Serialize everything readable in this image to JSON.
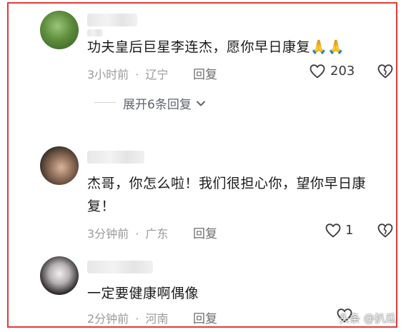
{
  "comments": [
    {
      "text": "功夫皇后巨星李连杰，愿你早日康复🙏🙏",
      "time": "3小时前",
      "location": "辽宁",
      "reply_label": "回复",
      "like_count": "203",
      "expand_label": "展开6条回复"
    },
    {
      "text_line1": "杰哥，你怎么啦！我们很担心你，望你早日康",
      "text_line2": "复！",
      "time": "3分钟前",
      "location": "广东",
      "reply_label": "回复",
      "like_count": "1"
    },
    {
      "text": "一定要健康啊偶像",
      "time": "2分钟前",
      "location": "河南",
      "reply_label": "回复"
    }
  ],
  "separator": "·",
  "watermark": "头条 @扒瓜",
  "colors": {
    "border": "#e23a3a",
    "meta": "#9a9a9a",
    "text": "#1a1a1a"
  }
}
